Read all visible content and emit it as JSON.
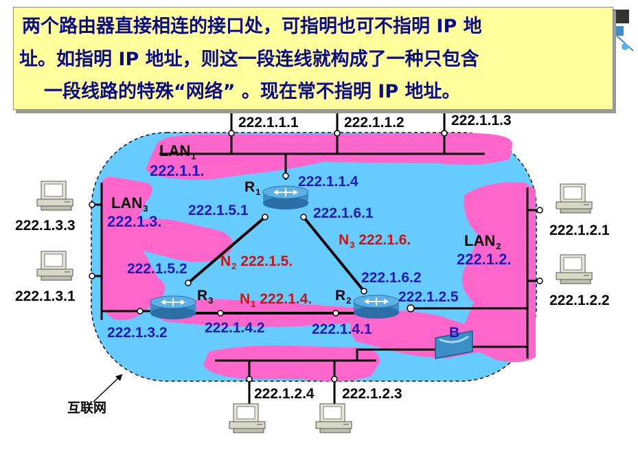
{
  "callout": {
    "line1": "两个路由器直接相连的接口处，可指明也可不指明 IP 地",
    "line2": "址。如指明 IP 地址，则这一段连线就构成了一种只包含",
    "line3": "一段线路的特殊“网络” 。现在常不指明 IP 地址。"
  },
  "internet_label": "互联网",
  "colors": {
    "cloud": "#66ccff",
    "lan_band": "#ff66cc",
    "ip_blue": "#1a1ab4",
    "net_red": "#c81414",
    "callout_bg": "#ffff9c",
    "callout_text": "#0a0a8c"
  },
  "lans": [
    {
      "id": "LAN",
      "sub": "1",
      "net": "222.1.1."
    },
    {
      "id": "LAN",
      "sub": "2",
      "net": "222.1.2."
    },
    {
      "id": "LAN",
      "sub": "3",
      "net": "222.1.3."
    }
  ],
  "links": [
    {
      "id": "N",
      "sub": "1",
      "net": "222.1.4."
    },
    {
      "id": "N",
      "sub": "2",
      "net": "222.1.5."
    },
    {
      "id": "N",
      "sub": "3",
      "net": "222.1.6."
    }
  ],
  "routers": [
    {
      "id": "R",
      "sub": "1",
      "icon": "router-icon"
    },
    {
      "id": "R",
      "sub": "2",
      "icon": "router-icon"
    },
    {
      "id": "R",
      "sub": "3",
      "icon": "router-icon"
    }
  ],
  "interfaces": {
    "r1_lan1": "222.1.1.4",
    "r1_n2": "222.1.5.1",
    "r1_n3": "222.1.6.1",
    "r2_n3": "222.1.6.2",
    "r2_lan2": "222.1.2.5",
    "r2_n1": "222.1.4.1",
    "r3_n2": "222.1.5.2",
    "r3_lan3": "222.1.3.2",
    "r3_n1": "222.1.4.2"
  },
  "hosts": {
    "lan1": [
      "222.1.1.1",
      "222.1.1.2",
      "222.1.1.3"
    ],
    "lan2": [
      "222.1.2.1",
      "222.1.2.2",
      "222.1.2.4",
      "222.1.2.3"
    ],
    "lan3": [
      "222.1.3.3",
      "222.1.3.1"
    ]
  },
  "bridge": {
    "label": "B",
    "icon": "bridge-icon"
  },
  "host_icon": "computer-icon"
}
